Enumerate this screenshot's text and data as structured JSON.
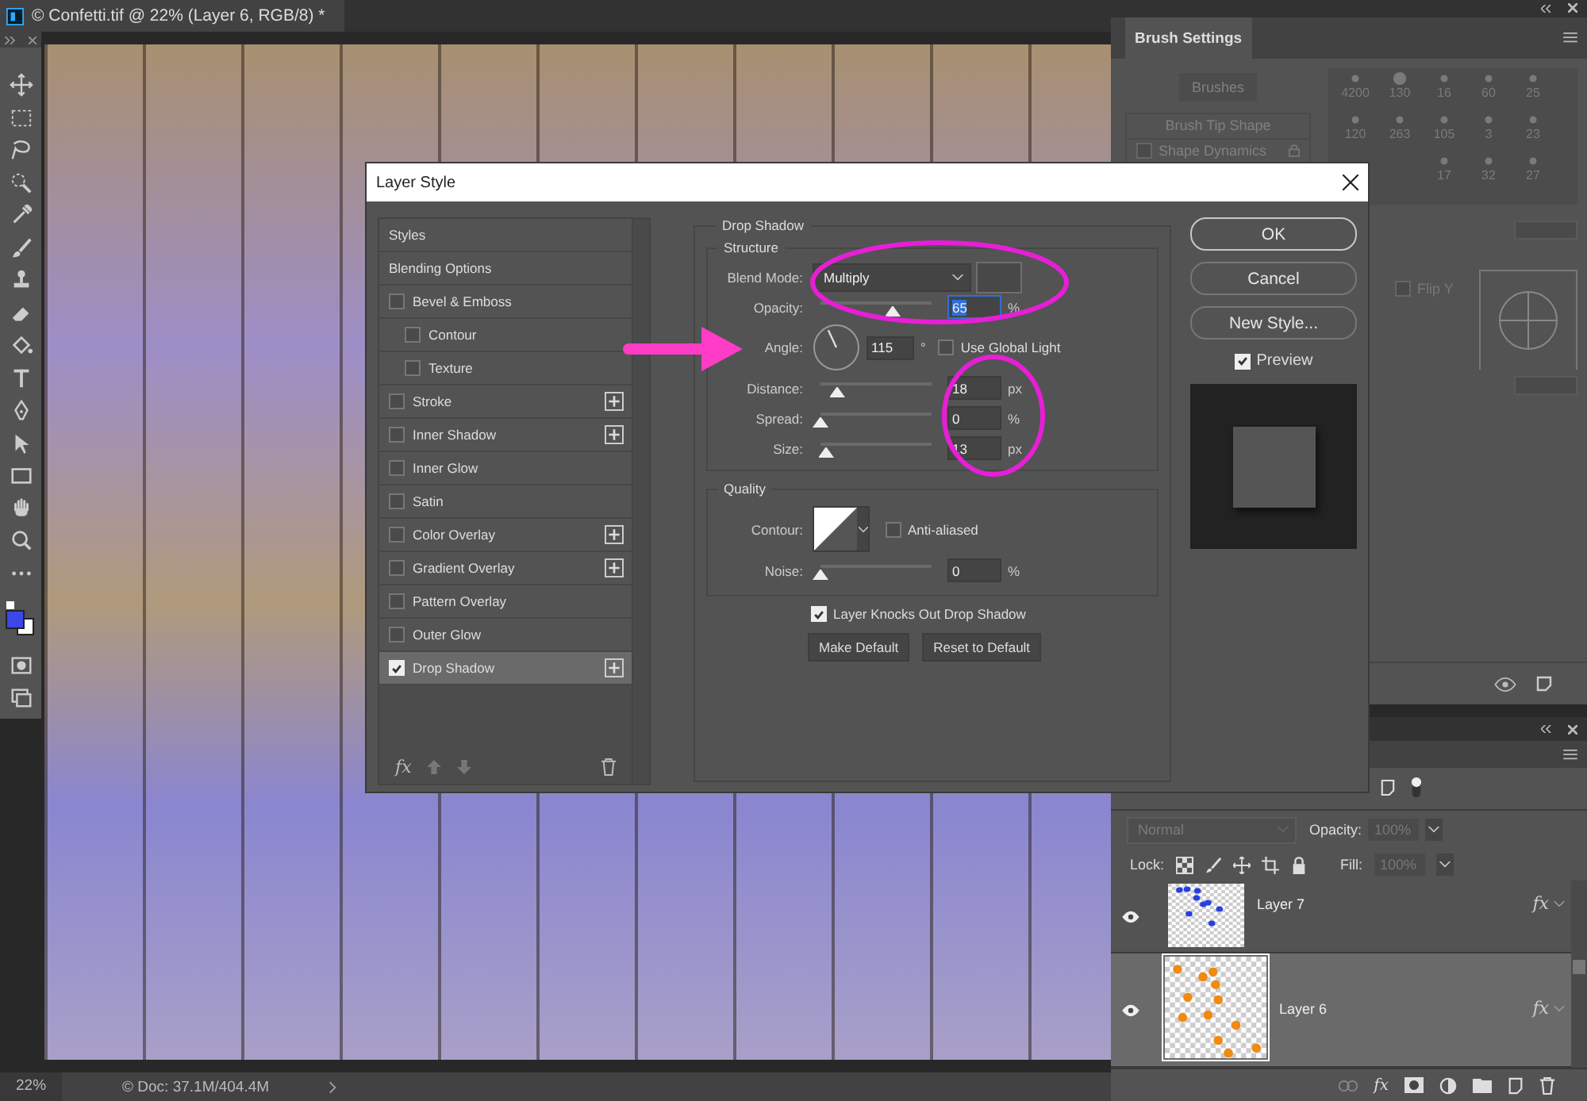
{
  "document_tab": {
    "title": "© Confetti.tif @ 22% (Layer 6, RGB/8) *"
  },
  "status_bar": {
    "zoom": "22%",
    "doc_info": "© Doc: 37.1M/404.4M"
  },
  "brush_settings": {
    "tab": "Brush Settings",
    "brushes_button": "Brushes",
    "options": [
      {
        "label": "Brush Tip Shape",
        "kind": "header"
      },
      {
        "label": "Shape Dynamics",
        "kind": "check",
        "checked": false
      }
    ],
    "presets": [
      "4200",
      "130",
      "16",
      "60",
      "25",
      "120",
      "263",
      "105",
      "3",
      "23",
      "17",
      "32",
      "27"
    ],
    "flip_y": {
      "label": "Flip Y",
      "checked": false
    }
  },
  "layers": {
    "blend_mode": "Normal",
    "opacity_label": "Opacity:",
    "opacity": "100%",
    "lock_label": "Lock:",
    "fill_label": "Fill:",
    "fill": "100%",
    "footer_fx": "fx",
    "items": [
      {
        "name": "Layer 7",
        "selected": false,
        "visible": true,
        "effects": "fx",
        "color": "#2a3fe0"
      },
      {
        "name": "Layer 6",
        "selected": true,
        "visible": true,
        "effects": "fx",
        "color": "#f08a10"
      }
    ]
  },
  "dialog": {
    "title": "Layer Style",
    "footer_fx": "fx",
    "styles": [
      {
        "label": "Styles",
        "kind": "header",
        "selected": false
      },
      {
        "label": "Blending Options",
        "kind": "header",
        "selected": false
      },
      {
        "label": "Bevel & Emboss",
        "kind": "effect",
        "checked": false,
        "selected": false,
        "add": false,
        "children": [
          {
            "label": "Contour",
            "kind": "effect",
            "checked": false,
            "selected": false,
            "add": false
          },
          {
            "label": "Texture",
            "kind": "effect",
            "checked": false,
            "selected": false,
            "add": false
          }
        ]
      },
      {
        "label": "Stroke",
        "kind": "effect",
        "checked": false,
        "selected": false,
        "add": true
      },
      {
        "label": "Inner Shadow",
        "kind": "effect",
        "checked": false,
        "selected": false,
        "add": true
      },
      {
        "label": "Inner Glow",
        "kind": "effect",
        "checked": false,
        "selected": false,
        "add": false
      },
      {
        "label": "Satin",
        "kind": "effect",
        "checked": false,
        "selected": false,
        "add": false
      },
      {
        "label": "Color Overlay",
        "kind": "effect",
        "checked": false,
        "selected": false,
        "add": true
      },
      {
        "label": "Gradient Overlay",
        "kind": "effect",
        "checked": false,
        "selected": false,
        "add": true
      },
      {
        "label": "Pattern Overlay",
        "kind": "effect",
        "checked": false,
        "selected": false,
        "add": false
      },
      {
        "label": "Outer Glow",
        "kind": "effect",
        "checked": false,
        "selected": false,
        "add": false
      },
      {
        "label": "Drop Shadow",
        "kind": "effect",
        "checked": true,
        "selected": true,
        "add": true
      }
    ],
    "panel": {
      "title": "Drop Shadow",
      "structure": {
        "title": "Structure",
        "rows": [
          {
            "kind": "blend",
            "label": "Blend Mode:",
            "value": "Multiply"
          },
          {
            "kind": "slider",
            "label": "Opacity:",
            "level": 0.65,
            "value": "65",
            "unit": "%",
            "focused": true
          },
          {
            "kind": "angle",
            "label": "Angle:",
            "value": "115",
            "unit": "°",
            "global_light": {
              "label": "Use Global Light",
              "checked": false
            }
          },
          {
            "kind": "slider",
            "label": "Distance:",
            "level": 0.15,
            "value": "18",
            "unit": "px",
            "focused": false
          },
          {
            "kind": "slider",
            "label": "Spread:",
            "level": 0,
            "value": "0",
            "unit": "%",
            "focused": false
          },
          {
            "kind": "slider",
            "label": "Size:",
            "level": 0.05,
            "value": "13",
            "unit": "px",
            "focused": false
          }
        ]
      },
      "quality": {
        "title": "Quality",
        "contour_label": "Contour:",
        "anti_aliased": {
          "label": "Anti-aliased",
          "checked": false
        },
        "noise": {
          "label": "Noise:",
          "level": 0,
          "value": "0",
          "unit": "%"
        }
      },
      "knockout": {
        "label": "Layer Knocks Out Drop Shadow",
        "checked": true
      },
      "buttons": [
        "Make Default",
        "Reset to Default"
      ]
    },
    "actions": [
      {
        "label": "OK",
        "default": true
      },
      {
        "label": "Cancel",
        "default": false
      },
      {
        "label": "New Style...",
        "default": false
      }
    ],
    "preview": {
      "label": "Preview",
      "checked": true
    }
  }
}
